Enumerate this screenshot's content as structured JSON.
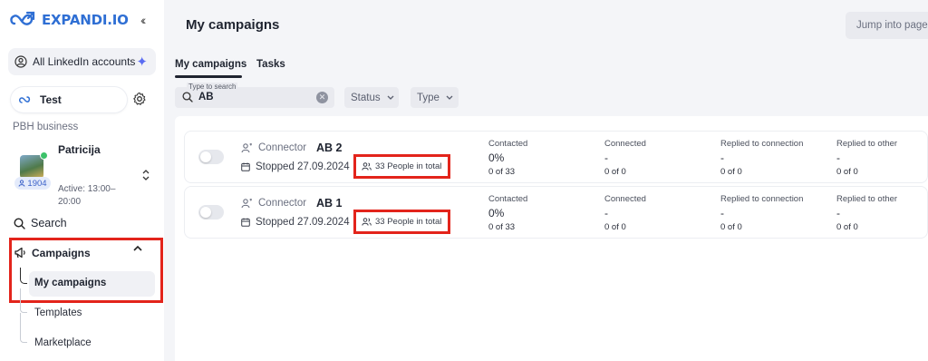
{
  "brand": {
    "name": "EXPANDI.IO",
    "accent": "#2f6fd4",
    "highlight": "#e3241b"
  },
  "sidebar": {
    "collapse_icon": "double-chevron-left-icon",
    "accounts_label": "All LinkedIn accounts",
    "workspace_label": "Test",
    "section_label": "PBH business",
    "user": {
      "name": "Patricija",
      "connections": "1904",
      "active": "Active: 13:00–20:00"
    },
    "nav": {
      "search": "Search",
      "campaigns": "Campaigns",
      "items": [
        "My campaigns",
        "Templates",
        "Marketplace"
      ]
    }
  },
  "header": {
    "title": "My campaigns",
    "jump_placeholder": "Jump into page..."
  },
  "tabs": [
    "My campaigns",
    "Tasks"
  ],
  "search": {
    "float_label": "Type to search",
    "value": "AB"
  },
  "filters": [
    "Status",
    "Type"
  ],
  "campaigns": [
    {
      "type": "Connector",
      "name": "AB 2",
      "status": "Stopped 27.09.2024",
      "people": "33 People in total",
      "stats": [
        {
          "label": "Contacted",
          "value": "0%",
          "sub": "0 of 33"
        },
        {
          "label": "Connected",
          "value": "-",
          "sub": "0 of 0"
        },
        {
          "label": "Replied to connection",
          "value": "-",
          "sub": "0 of 0"
        },
        {
          "label": "Replied to other",
          "value": "-",
          "sub": "0 of 0"
        }
      ]
    },
    {
      "type": "Connector",
      "name": "AB 1",
      "status": "Stopped 27.09.2024",
      "people": "33 People in total",
      "stats": [
        {
          "label": "Contacted",
          "value": "0%",
          "sub": "0 of 33"
        },
        {
          "label": "Connected",
          "value": "-",
          "sub": "0 of 0"
        },
        {
          "label": "Replied to connection",
          "value": "-",
          "sub": "0 of 0"
        },
        {
          "label": "Replied to other",
          "value": "-",
          "sub": "0 of 0"
        }
      ]
    }
  ]
}
